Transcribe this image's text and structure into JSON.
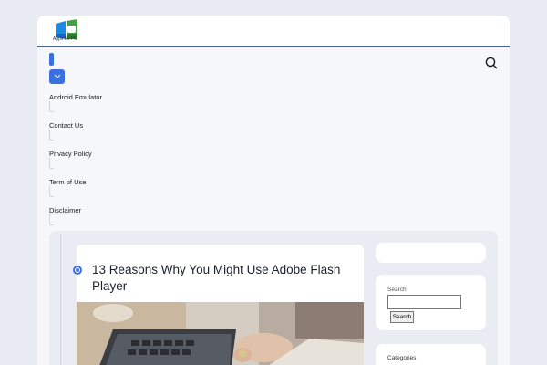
{
  "header": {
    "logo_text": "Apps for PC"
  },
  "nav": {
    "items": [
      {
        "label": "Android Emulator"
      },
      {
        "label": "Contact Us"
      },
      {
        "label": "Privacy Policy"
      },
      {
        "label": "Term of Use"
      },
      {
        "label": "Disclaimer"
      }
    ]
  },
  "post": {
    "title": "13 Reasons Why You Might Use Adobe Flash Player"
  },
  "sidebar": {
    "search_label": "Search",
    "search_value": "",
    "search_button": "Search",
    "categories_title": "Categories"
  },
  "colors": {
    "accent": "#3b6fe0",
    "header_border": "#4a6b8f",
    "background": "#e8ebf1"
  },
  "icons": {
    "top_search": "search-icon",
    "menu_toggle": "chevron-down-icon"
  }
}
